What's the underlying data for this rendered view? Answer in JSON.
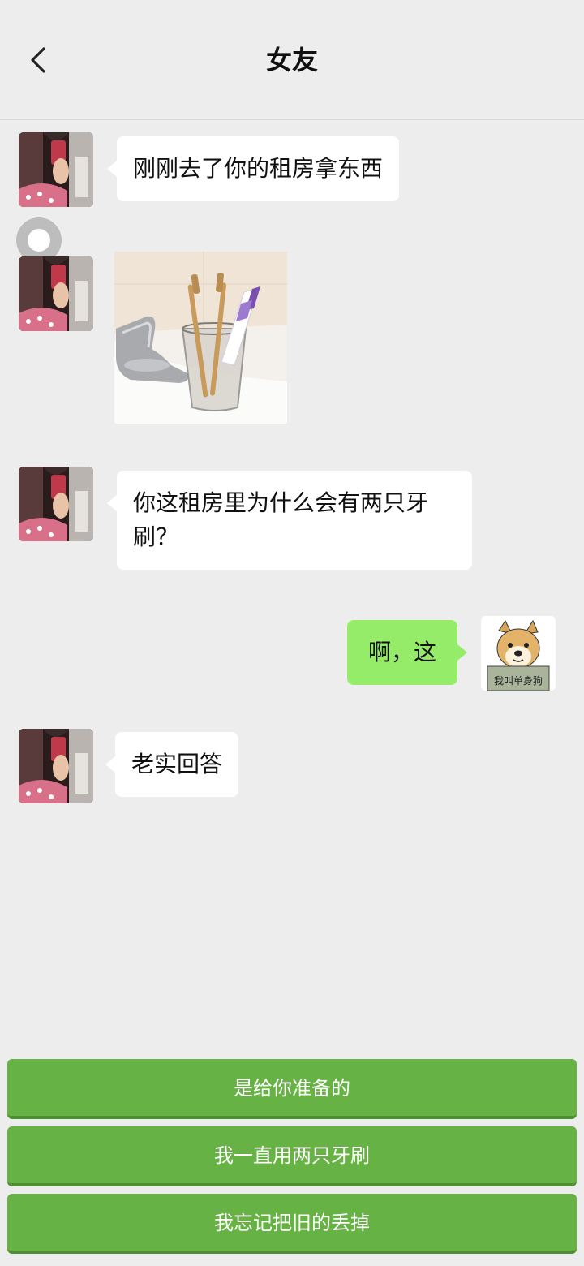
{
  "header": {
    "title": "女友",
    "back_icon": "chevron-left-icon"
  },
  "messages": [
    {
      "from": "contact",
      "type": "text",
      "text": "刚刚去了你的租房拿东西"
    },
    {
      "from": "contact",
      "type": "image",
      "image": "toothbrush-cup-photo"
    },
    {
      "from": "contact",
      "type": "text",
      "text": "你这租房里为什么会有两只牙刷？"
    },
    {
      "from": "me",
      "type": "text",
      "text": "啊，这"
    },
    {
      "from": "contact",
      "type": "text",
      "text": "老实回答"
    }
  ],
  "me_avatar": {
    "caption": "我叫单身狗"
  },
  "choices": [
    {
      "label": "是给你准备的"
    },
    {
      "label": "我一直用两只牙刷"
    },
    {
      "label": "我忘记把旧的丢掉"
    }
  ],
  "colors": {
    "background": "#ededed",
    "my_bubble": "#95ec69",
    "their_bubble": "#ffffff",
    "choice_button": "#67b244"
  }
}
